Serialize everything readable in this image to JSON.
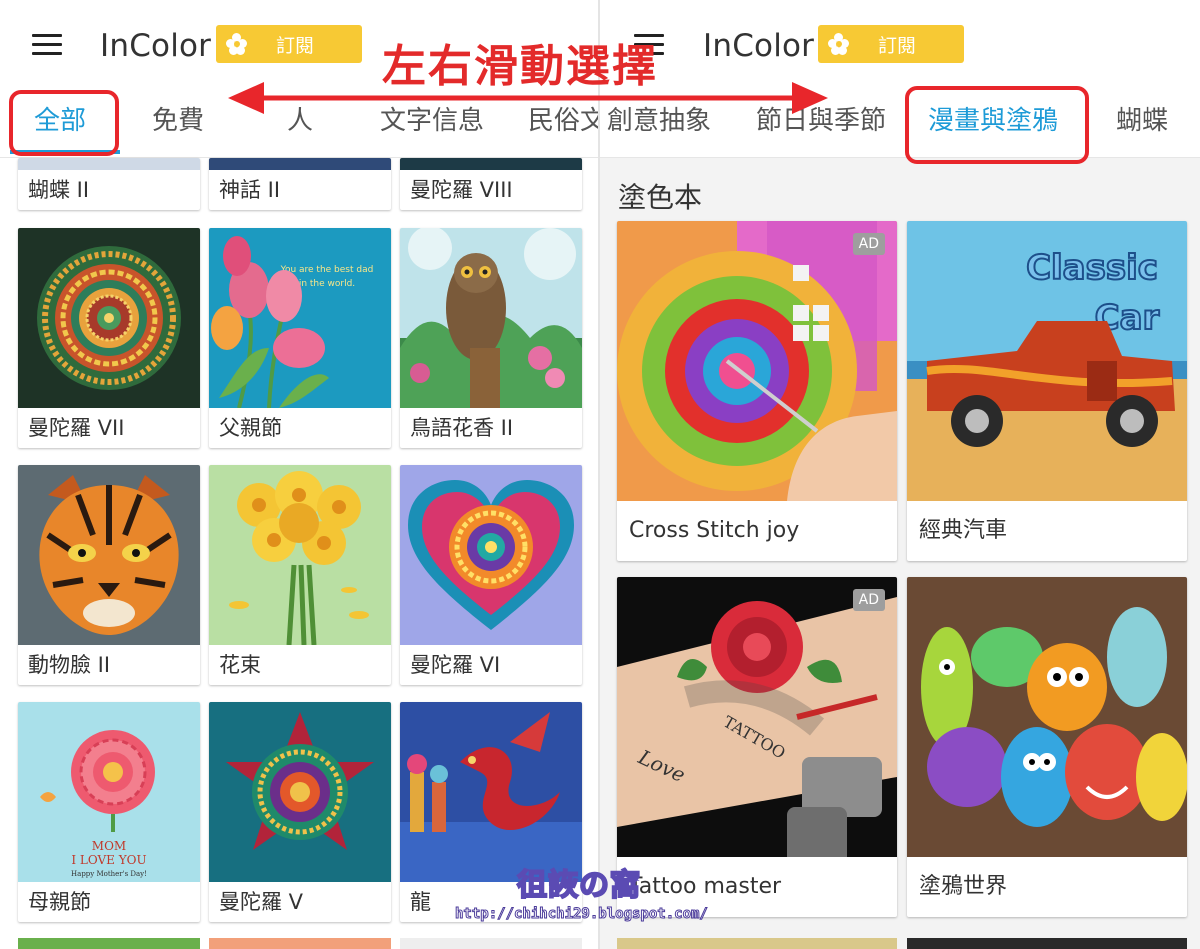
{
  "app": {
    "title": "InColor",
    "subscribe_label": "訂閱"
  },
  "annotation": {
    "title": "左右滑動選擇"
  },
  "left": {
    "tabs": [
      "全部",
      "免費",
      "人",
      "文字信息",
      "民俗文"
    ],
    "active_tab": "全部",
    "top_partial_captions": [
      "蝴蝶 II",
      "神話 II",
      "曼陀羅 VIII"
    ],
    "cards": [
      {
        "caption": "曼陀羅 VII"
      },
      {
        "caption": "父親節",
        "art_text_1": "You are the best dad",
        "art_text_2": "in the world."
      },
      {
        "caption": "鳥語花香 II"
      },
      {
        "caption": "動物臉 II"
      },
      {
        "caption": "花束"
      },
      {
        "caption": "曼陀羅 VI"
      },
      {
        "caption": "母親節",
        "art_text_1": "MOM",
        "art_text_2": "I LOVE YOU",
        "art_text_3": "Happy Mother's Day!"
      },
      {
        "caption": "曼陀羅 V"
      },
      {
        "caption": "龍"
      }
    ]
  },
  "right": {
    "tabs": [
      "創意抽象",
      "節日與季節",
      "漫畫與塗鴉",
      "蝴蝶"
    ],
    "active_tab": "漫畫與塗鴉",
    "section_title": "塗色本",
    "cards": [
      {
        "caption": "Cross Stitch joy",
        "badge": "AD"
      },
      {
        "caption": "經典汽車",
        "art_text_1": "Classic",
        "art_text_2": "Car"
      },
      {
        "caption": "Tattoo master",
        "badge": "AD",
        "art_text_1": "TATTOO",
        "art_text_2": "Love"
      },
      {
        "caption": "塗鴉世界"
      }
    ]
  },
  "watermark": {
    "title": "徂詼の窩",
    "url": "http://chihchi29.blogspot.com/"
  },
  "colors": {
    "accent": "#1e9bd7",
    "subscribe": "#f7c934",
    "annotation": "#e8262b"
  }
}
